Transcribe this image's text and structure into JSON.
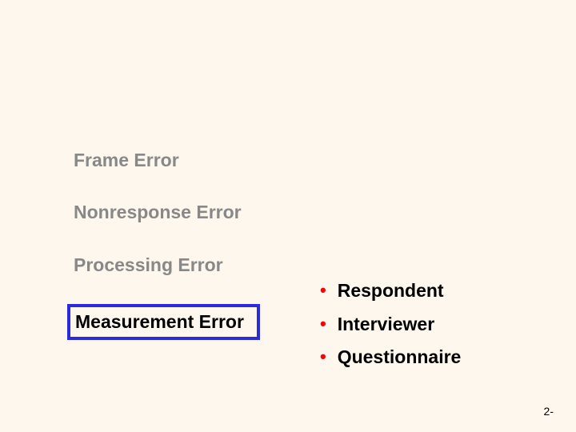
{
  "left": {
    "items": [
      "Frame Error",
      "Nonresponse Error",
      "Processing Error",
      "Measurement Error"
    ]
  },
  "right": {
    "items": [
      "Respondent",
      "Interviewer",
      "Questionnaire"
    ]
  },
  "footer": {
    "page": "2-"
  }
}
